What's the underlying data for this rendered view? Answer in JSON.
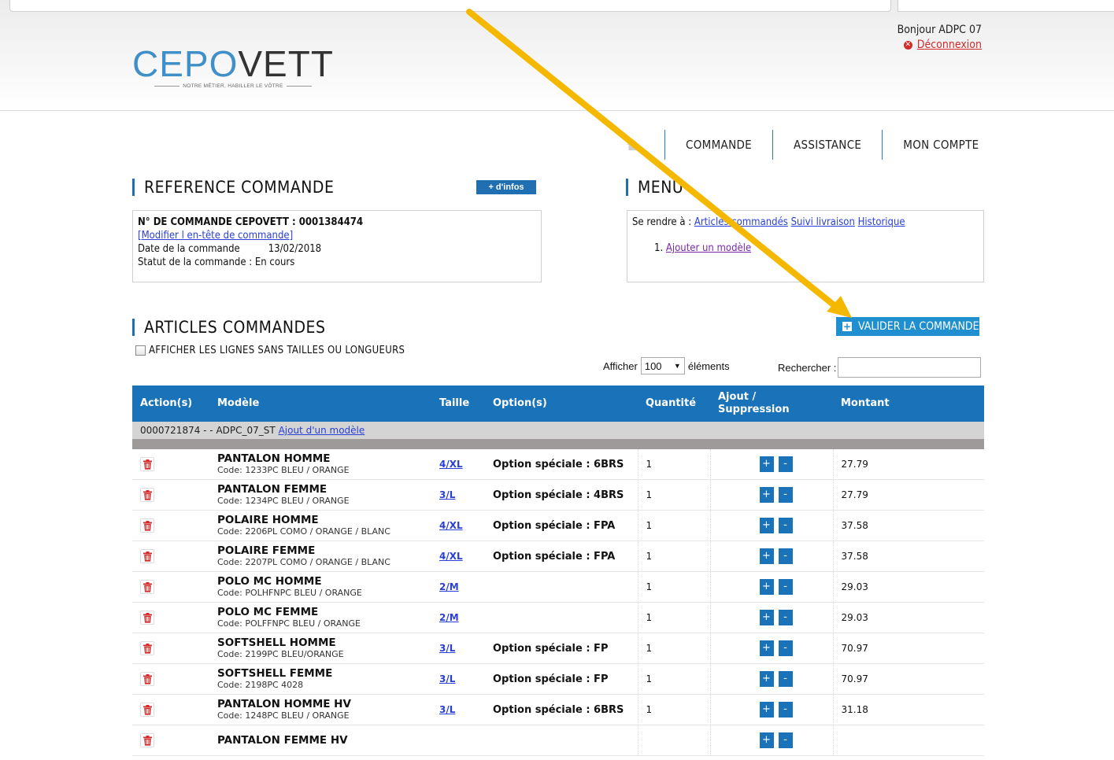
{
  "header": {
    "logo": {
      "part1": "CEPO",
      "part2": "VETT",
      "tagline": "NOTRE MÉTIER, HABILLER LE VÔTRE"
    },
    "greeting": "Bonjour ADPC 07",
    "logout": "Déconnexion"
  },
  "nav": {
    "home_icon": "home-icon",
    "items": [
      "COMMANDE",
      "ASSISTANCE",
      "MON COMPTE"
    ]
  },
  "reference": {
    "title": "REFERENCE COMMANDE",
    "info_button": "+ d'infos",
    "order_number": "N° DE COMMANDE CEPOVETT : 0001384474",
    "modify_link": "[Modifier l en-tête de commande]",
    "date_label": "Date de la commande",
    "date_value": "13/02/2018",
    "status": "Statut de la commande : En cours"
  },
  "menu": {
    "title": "MENU",
    "goto_label": "Se rendre à :",
    "links": [
      "Articles commandés",
      "Suivi livraison",
      "Historique"
    ],
    "list_num": "1.",
    "add_model": "Ajouter un modèle"
  },
  "articles": {
    "title": "ARTICLES COMMANDES",
    "validate_button": "VALIDER LA COMMANDE",
    "checkbox_label": "AFFICHER LES LIGNES SANS TAILLES OU LONGUEURS",
    "show_label": "Afficher",
    "show_value": "100",
    "show_suffix": "éléments",
    "search_label": "Rechercher :",
    "columns": [
      "Action(s)",
      "Modèle",
      "Taille",
      "Option(s)",
      "Quantité",
      "Ajout / Suppression",
      "Montant"
    ],
    "group": {
      "text": "0000721874 - - ADPC_07_ST",
      "link": "Ajout d'un modèle"
    },
    "rows": [
      {
        "name": "PANTALON HOMME",
        "code": "Code: 1233PC BLEU / ORANGE",
        "size": "4/XL",
        "option": "Option spéciale : 6BRS",
        "qty": "1",
        "amount": "27.79"
      },
      {
        "name": "PANTALON FEMME",
        "code": "Code: 1234PC BLEU / ORANGE",
        "size": "3/L",
        "option": "Option spéciale : 4BRS",
        "qty": "1",
        "amount": "27.79"
      },
      {
        "name": "POLAIRE HOMME",
        "code": "Code: 2206PL COMO / ORANGE / BLANC",
        "size": "4/XL",
        "option": "Option spéciale : FPA",
        "qty": "1",
        "amount": "37.58"
      },
      {
        "name": "POLAIRE FEMME",
        "code": "Code: 2207PL COMO / ORANGE / BLANC",
        "size": "4/XL",
        "option": "Option spéciale : FPA",
        "qty": "1",
        "amount": "37.58"
      },
      {
        "name": "POLO MC HOMME",
        "code": "Code: POLHFNPC BLEU / ORANGE",
        "size": "2/M",
        "option": "",
        "qty": "1",
        "amount": "29.03"
      },
      {
        "name": "POLO MC FEMME",
        "code": "Code: POLFFNPC BLEU / ORANGE",
        "size": "2/M",
        "option": "",
        "qty": "1",
        "amount": "29.03"
      },
      {
        "name": "SOFTSHELL HOMME",
        "code": "Code: 2199PC BLEU/ORANGE",
        "size": "3/L",
        "option": "Option spéciale : FP",
        "qty": "1",
        "amount": "70.97"
      },
      {
        "name": "SOFTSHELL FEMME",
        "code": "Code: 2198PC 4028",
        "size": "3/L",
        "option": "Option spéciale : FP",
        "qty": "1",
        "amount": "70.97"
      },
      {
        "name": "PANTALON HOMME HV",
        "code": "Code: 1248PC BLEU / ORANGE",
        "size": "3/L",
        "option": "Option spéciale : 6BRS",
        "qty": "1",
        "amount": "31.18"
      },
      {
        "name": "PANTALON FEMME HV",
        "code": "",
        "size": "",
        "option": "",
        "qty": "",
        "amount": ""
      }
    ]
  },
  "colors": {
    "primary": "#1a73b8",
    "accent_arrow": "#f5b800",
    "danger": "#d32b2b"
  }
}
